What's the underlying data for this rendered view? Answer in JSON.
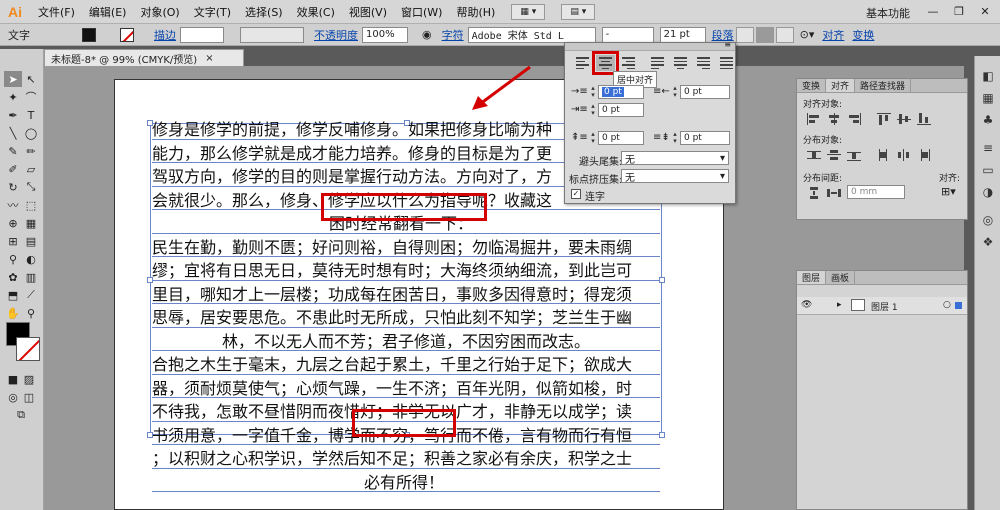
{
  "app": {
    "logo": "Ai",
    "workspace": "基本功能"
  },
  "menu": [
    "文件(F)",
    "编辑(E)",
    "对象(O)",
    "文字(T)",
    "选择(S)",
    "效果(C)",
    "视图(V)",
    "窗口(W)",
    "帮助(H)"
  ],
  "control": {
    "tool_label": "文字",
    "stroke_label": "描边",
    "opacity_label": "不透明度",
    "opacity_value": "100%",
    "char_label": "字符",
    "font": "Adobe 宋体 Std L",
    "style": "-",
    "size": "21 pt",
    "para_label": "段落",
    "align_label": "对齐",
    "transform_label": "变换"
  },
  "doc_tab": {
    "title": "未标题-8* @ 99% (CMYK/预览)",
    "close": "×"
  },
  "paragraph_panel": {
    "tooltip": "居中对齐",
    "fields": [
      "0 pt",
      "0 pt",
      "0 pt",
      "0 pt",
      "0 pt"
    ],
    "selected_field": "0 pt",
    "kinsoku_label": "避头尾集:",
    "kinsoku_value": "无",
    "mojikumi_label": "标点挤压集:",
    "mojikumi_value": "无",
    "hyphen_label": "连字"
  },
  "align_panel": {
    "tabs": [
      "变换",
      "对齐",
      "路径查找器"
    ],
    "align_objects": "对齐对象:",
    "distribute_objects": "分布对象:",
    "distribute_spacing": "分布间距:",
    "align_to": "对齐:",
    "spacing_value": "0 mm"
  },
  "layers_panel": {
    "tabs": [
      "图层",
      "画板"
    ],
    "layer_name": "图层 1"
  },
  "text": {
    "lines": [
      "修身是修学的前提，修学反哺修身。如果把修身比喻为种",
      "能力，那么修学就是成才能力培养。修身的目标是为了更",
      "驾驭方向，修学的目的则是掌握行动方法。方向对了，方",
      "会就很少。那么，修身、修学应以什么为指导呢？收藏这",
      "困时经常翻看一下：",
      "民生在勤，勤则不匮；好问则裕，自得则困；勿临渴掘井，要未雨绸",
      "缪；宜将有日思无日，莫待无时想有时；大海终须纳细流，到此岂可",
      "里目，哪知才上一层楼；功成每在困苦日，事败多因得意时；得宠须",
      "思辱，居安要思危。不患此时无所成，只怕此刻不知学；芝兰生于幽",
      "林，不以无人而不芳；君子修道，不因穷困而改志。",
      "合抱之木生于毫末，九层之台起于累土，千里之行始于足下；欲成大",
      "器，须耐烦莫使气；心烦气躁，一生不济；百年光阴，似箭如梭，时",
      "不待我，怎敢不昼惜阴而夜惜灯；非学无以广才，非静无以成学；读",
      "书须用意，一字值千金，博学而不穷，笃行而不倦，言有物而行有恒",
      "；以积财之心积学识，学然后知不足；积善之家必有余庆，积学之士",
      "必有所得！"
    ]
  },
  "colors": {
    "highlight": "#d40000",
    "guide": "#6b86c8",
    "accent": "#f08a1c"
  }
}
